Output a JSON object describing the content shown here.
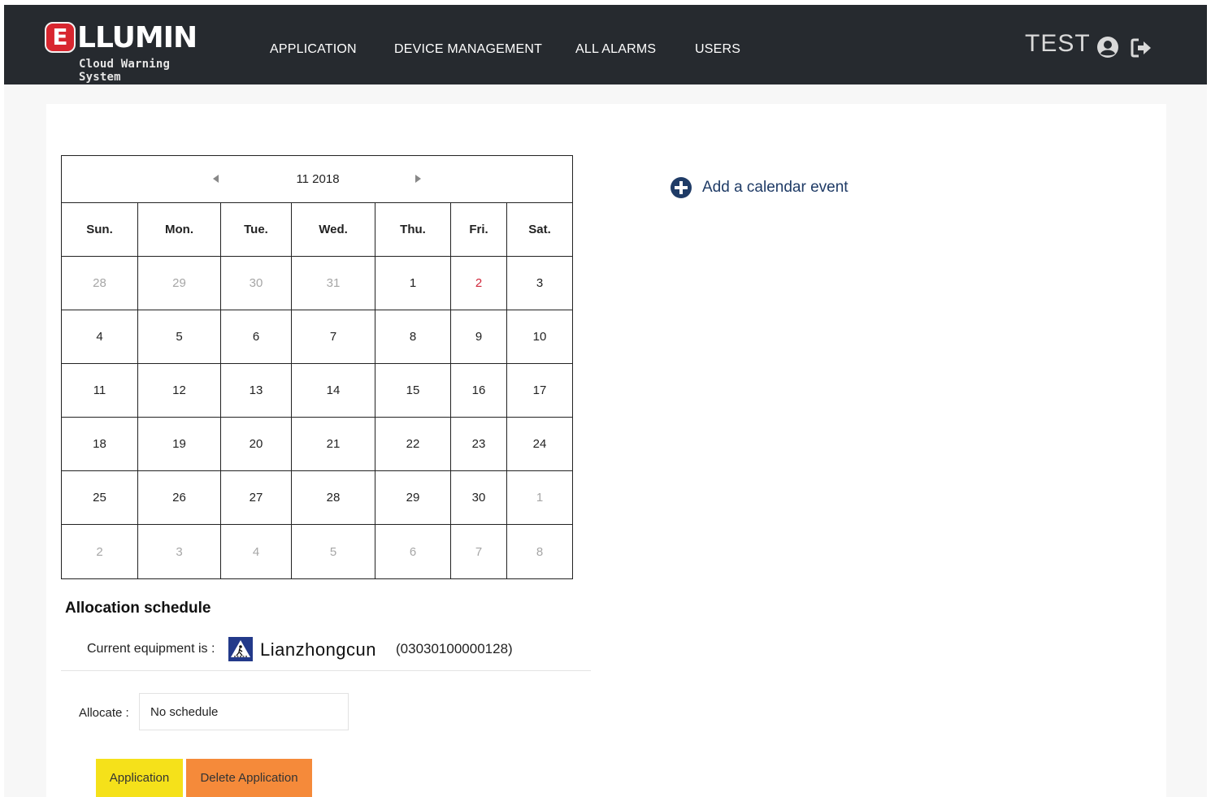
{
  "brand": {
    "logo_letter": "E",
    "logo_rest": "LLUMIN",
    "subtitle": "Cloud Warning System"
  },
  "nav": {
    "items": [
      "APPLICATION",
      "DEVICE MANAGEMENT",
      "ALL ALARMS",
      "USERS"
    ]
  },
  "user": {
    "name": "TEST",
    "icons": [
      "user-circle-icon",
      "logout-icon"
    ]
  },
  "calendar": {
    "month_label": "11 2018",
    "day_names": [
      "Sun.",
      "Mon.",
      "Tue.",
      "Wed.",
      "Thu.",
      "Fri.",
      "Sat."
    ],
    "weeks": [
      [
        {
          "d": "28",
          "m": true
        },
        {
          "d": "29",
          "m": true
        },
        {
          "d": "30",
          "m": true
        },
        {
          "d": "31",
          "m": true
        },
        {
          "d": "1"
        },
        {
          "d": "2",
          "today": true
        },
        {
          "d": "3"
        }
      ],
      [
        {
          "d": "4"
        },
        {
          "d": "5"
        },
        {
          "d": "6"
        },
        {
          "d": "7"
        },
        {
          "d": "8"
        },
        {
          "d": "9"
        },
        {
          "d": "10"
        }
      ],
      [
        {
          "d": "11"
        },
        {
          "d": "12"
        },
        {
          "d": "13"
        },
        {
          "d": "14"
        },
        {
          "d": "15"
        },
        {
          "d": "16"
        },
        {
          "d": "17"
        }
      ],
      [
        {
          "d": "18"
        },
        {
          "d": "19"
        },
        {
          "d": "20"
        },
        {
          "d": "21"
        },
        {
          "d": "22"
        },
        {
          "d": "23"
        },
        {
          "d": "24"
        }
      ],
      [
        {
          "d": "25"
        },
        {
          "d": "26"
        },
        {
          "d": "27"
        },
        {
          "d": "28"
        },
        {
          "d": "29"
        },
        {
          "d": "30"
        },
        {
          "d": "1",
          "m": true
        }
      ],
      [
        {
          "d": "2",
          "m": true
        },
        {
          "d": "3",
          "m": true
        },
        {
          "d": "4",
          "m": true
        },
        {
          "d": "5",
          "m": true
        },
        {
          "d": "6",
          "m": true
        },
        {
          "d": "7",
          "m": true
        },
        {
          "d": "8",
          "m": true
        }
      ]
    ]
  },
  "add_event": {
    "label": "Add a calendar event"
  },
  "allocation": {
    "title": "Allocation schedule",
    "current_label": "Current equipment is :",
    "equipment_name": "Lianzhongcun",
    "equipment_id": "(03030100000128)",
    "allocate_label": "Allocate :",
    "allocate_value": "No schedule",
    "application_button": "Application",
    "delete_button": "Delete Application"
  },
  "colors": {
    "topbar": "#262a2f",
    "logo_red": "#d8262f",
    "today_red": "#d0263a",
    "add_event_blue": "#1f3b66",
    "application_yellow": "#f5e11a",
    "delete_orange": "#f58a3a",
    "equipment_icon_blue": "#233a8a"
  }
}
